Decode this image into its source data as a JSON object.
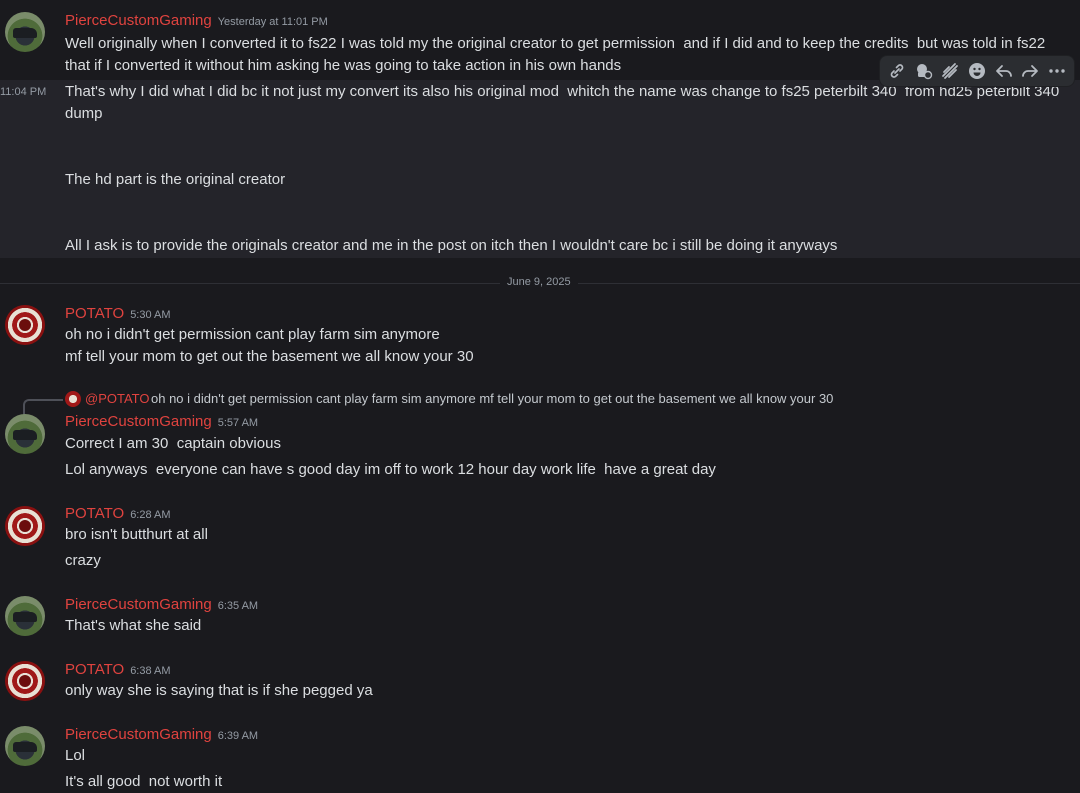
{
  "users": {
    "pierce": "PierceCustomGaming",
    "potato": "POTATO"
  },
  "toolbar": {
    "icons": [
      "link-icon",
      "thread-icon",
      "super-reaction-icon",
      "emoji-icon",
      "reply-icon",
      "forward-icon",
      "more-icon"
    ]
  },
  "messages": {
    "m1": {
      "author": "PierceCustomGaming",
      "timestamp": "Yesterday at 11:01 PM",
      "line1": "Well originally when I converted it to fs22 I was told my the original creator to get permission  and if I did and to keep the credits  but was told in fs22 that if I converted it without him asking he was going to take action in his own hands"
    },
    "m2": {
      "side_timestamp": "11:04 PM",
      "line1": "That's why I did what I did bc it not just my convert its also his original mod  whitch the name was change to fs25 peterbilt 340  from hd25 peterbilt 340 dump",
      "line2": "The hd part is the original creator",
      "line3": "All I ask is to provide the originals creator and me in the post on itch then I wouldn't care bc i still be doing it anyways"
    },
    "date_divider": "June 9, 2025",
    "m3": {
      "author": "POTATO",
      "timestamp": "5:30 AM",
      "line1": "oh no i didn't get permission cant play farm sim anymore",
      "line2": "mf tell your mom to get out the basement we all know your 30"
    },
    "m4": {
      "reply_mention": "@POTATO",
      "reply_text": "oh no i didn't get permission cant play farm sim anymore mf tell your mom to get out the basement we all know your 30",
      "author": "PierceCustomGaming",
      "timestamp": "5:57 AM",
      "line1": "Correct I am 30  captain obvious",
      "line2": "Lol anyways  everyone can have s good day im off to work 12 hour day work life  have a great day"
    },
    "m5": {
      "author": "POTATO",
      "timestamp": "6:28 AM",
      "line1": "bro isn't butthurt at all",
      "line2": "crazy"
    },
    "m6": {
      "author": "PierceCustomGaming",
      "timestamp": "6:35 AM",
      "line1": "That's what she said"
    },
    "m7": {
      "author": "POTATO",
      "timestamp": "6:38 AM",
      "line1": "only way she is saying that is if she pegged ya"
    },
    "m8": {
      "author": "PierceCustomGaming",
      "timestamp": "6:39 AM",
      "line1": "Lol",
      "line2": "It's all good  not worth it"
    }
  }
}
